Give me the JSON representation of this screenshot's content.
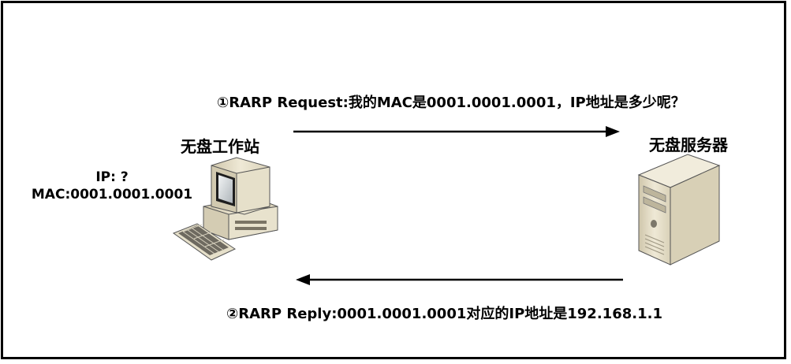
{
  "request": {
    "label": "①RARP Request:我的MAC是0001.0001.0001，IP地址是多少呢？"
  },
  "reply": {
    "label": "②RARP Reply:0001.0001.0001对应的IP地址是192.168.1.1"
  },
  "workstation": {
    "title": "无盘工作站",
    "ip": "IP: ?",
    "mac": "MAC:0001.0001.0001",
    "icon": "desktop-computer-icon"
  },
  "server": {
    "title": "无盘服务器",
    "icon": "server-tower-icon"
  },
  "colors": {
    "line": "#000000",
    "device_beige": "#e3dcc6",
    "screen": "#cfd3d6"
  }
}
